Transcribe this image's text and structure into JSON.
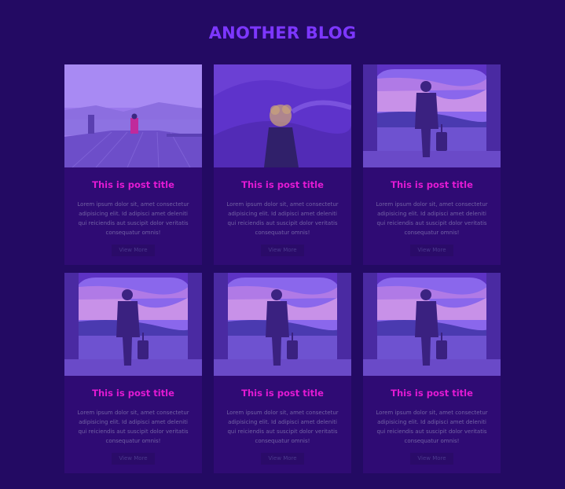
{
  "blog": {
    "title": "ANOTHER BLOG",
    "colors": {
      "background": "#230a63",
      "heading": "#7d37ff",
      "card": "#2f0b74",
      "post_title": "#e21ad3",
      "body_text": "#7262a4"
    }
  },
  "posts": [
    {
      "title": "This is post title",
      "excerpt": "Lorem ipsum dolor sit, amet consectetur adipisicing elit. Id adipisci amet deleniti qui reiciendis aut suscipit dolor veritatis consequatur omnis!",
      "button": "View More",
      "image": "pier-photo"
    },
    {
      "title": "This is post title",
      "excerpt": "Lorem ipsum dolor sit, amet consectetur adipisicing elit. Id adipisci amet deleniti qui reiciendis aut suscipit dolor veritatis consequatur omnis!",
      "button": "View More",
      "image": "curly-hair-photo"
    },
    {
      "title": "This is post title",
      "excerpt": "Lorem ipsum dolor sit, amet consectetur adipisicing elit. Id adipisci amet deleniti qui reiciendis aut suscipit dolor veritatis consequatur omnis!",
      "button": "View More",
      "image": "traveler-window-photo"
    },
    {
      "title": "This is post title",
      "excerpt": "Lorem ipsum dolor sit, amet consectetur adipisicing elit. Id adipisci amet deleniti qui reiciendis aut suscipit dolor veritatis consequatur omnis!",
      "button": "View More",
      "image": "traveler-window-photo"
    },
    {
      "title": "This is post title",
      "excerpt": "Lorem ipsum dolor sit, amet consectetur adipisicing elit. Id adipisci amet deleniti qui reiciendis aut suscipit dolor veritatis consequatur omnis!",
      "button": "View More",
      "image": "traveler-window-photo"
    },
    {
      "title": "This is post title",
      "excerpt": "Lorem ipsum dolor sit, amet consectetur adipisicing elit. Id adipisci amet deleniti qui reiciendis aut suscipit dolor veritatis consequatur omnis!",
      "button": "View More",
      "image": "traveler-window-photo"
    }
  ]
}
